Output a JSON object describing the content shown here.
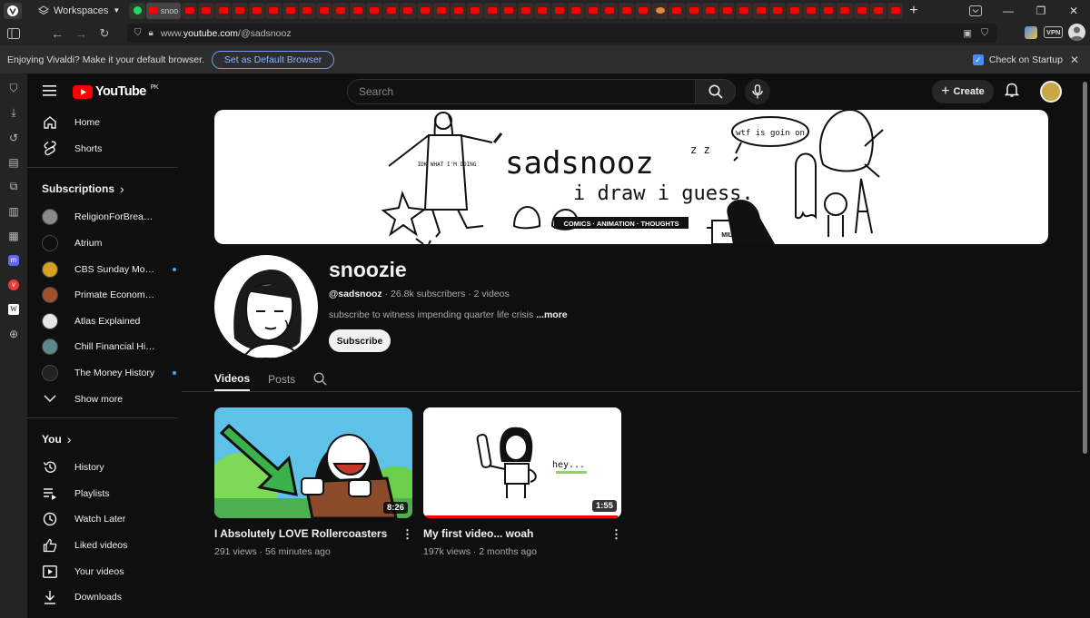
{
  "browser": {
    "workspaces_label": "Workspaces",
    "active_tab_title": "snoo",
    "url_prefix": "www.",
    "url_domain": "youtube.com",
    "url_path": "/@sadsnooz",
    "notice_text": "Enjoying Vivaldi? Make it your default browser.",
    "set_default_label": "Set as Default Browser",
    "check_startup_label": "Check on Startup",
    "vpn_label": "VPN"
  },
  "youtube": {
    "logo_text": "YouTube",
    "region": "PK",
    "search_placeholder": "Search",
    "create_label": "Create"
  },
  "sidebar": {
    "main": [
      {
        "label": "Home",
        "icon": "home-icon"
      },
      {
        "label": "Shorts",
        "icon": "shorts-icon"
      }
    ],
    "subscriptions_title": "Subscriptions",
    "subscriptions": [
      {
        "label": "ReligionForBreakfast",
        "color": "#8a8a8a",
        "new": false
      },
      {
        "label": "Atrium",
        "color": "#0f0f0f",
        "new": false
      },
      {
        "label": "CBS Sunday Morning",
        "color": "#d4a11e",
        "new": true
      },
      {
        "label": "Primate Economics",
        "color": "#a0522d",
        "new": false
      },
      {
        "label": "Atlas Explained",
        "color": "#e6e6e6",
        "new": false
      },
      {
        "label": "Chill Financial History",
        "color": "#5c8a8a",
        "new": false
      },
      {
        "label": "The Money History",
        "color": "#222222",
        "new": true
      }
    ],
    "show_more_label": "Show more",
    "you_title": "You",
    "you_items": [
      {
        "label": "History",
        "icon": "history-icon"
      },
      {
        "label": "Playlists",
        "icon": "playlists-icon"
      },
      {
        "label": "Watch Later",
        "icon": "watch-later-icon"
      },
      {
        "label": "Liked videos",
        "icon": "like-icon"
      },
      {
        "label": "Your videos",
        "icon": "your-videos-icon"
      },
      {
        "label": "Downloads",
        "icon": "download-icon"
      }
    ]
  },
  "channel": {
    "banner_title": "sadsnooz",
    "banner_subtitle": "i draw i guess.",
    "banner_tagline": "COMICS · ANIMATION · THOUGHTS",
    "banner_bubble": "wtf is goin on",
    "banner_shirt": "IDK WHAT I'M DOING",
    "banner_mug": "MILO",
    "name": "snoozie",
    "handle": "@sadsnooz",
    "subscribers": "26.8k subscribers",
    "video_count": "2 videos",
    "description": "subscribe to witness impending quarter life crisis",
    "more_label": "...more",
    "subscribe_label": "Subscribe",
    "tabs": [
      "Videos",
      "Posts"
    ]
  },
  "videos": [
    {
      "title": "I Absolutely LOVE Rollercoasters",
      "views": "291 views",
      "age": "56 minutes ago",
      "duration": "8:26"
    },
    {
      "title": "My first video... woah",
      "views": "197k views",
      "age": "2 months ago",
      "duration": "1:55",
      "thumb_text": "hey...",
      "watched_fraction": 0.98
    }
  ],
  "colors": {
    "youtube_red": "#ff0000",
    "vivaldi_blue": "#4b8cf0",
    "link_blue": "#3ea6ff"
  }
}
